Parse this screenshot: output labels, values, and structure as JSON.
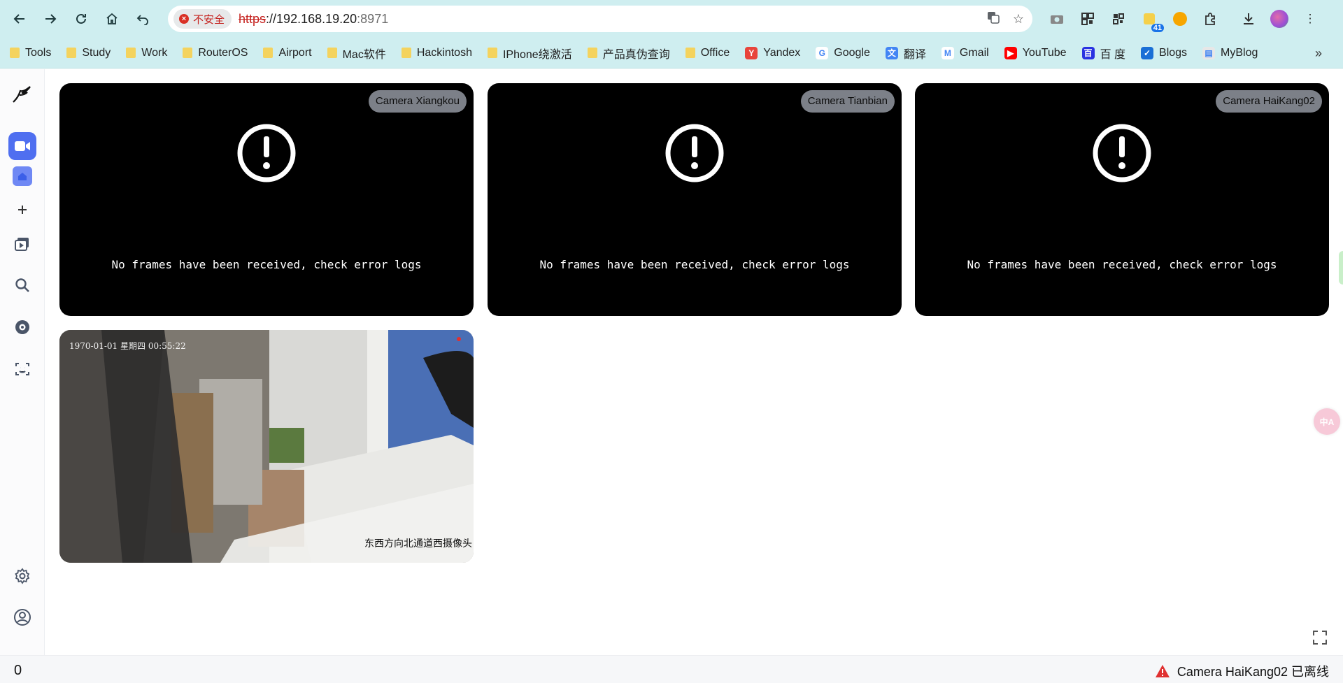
{
  "browser": {
    "security_label": "不安全",
    "url_scheme": "https",
    "url_host": "://192.168.19.20",
    "url_port": ":8971",
    "extension_badge": "41"
  },
  "bookmarks": [
    {
      "label": "Tools",
      "icon": "folder-icon"
    },
    {
      "label": "Study",
      "icon": "folder-icon"
    },
    {
      "label": "Work",
      "icon": "folder-icon"
    },
    {
      "label": "RouterOS",
      "icon": "folder-icon"
    },
    {
      "label": "Airport",
      "icon": "folder-icon"
    },
    {
      "label": "Mac软件",
      "icon": "folder-icon"
    },
    {
      "label": "Hackintosh",
      "icon": "folder-icon"
    },
    {
      "label": "IPhone绕激活",
      "icon": "folder-icon"
    },
    {
      "label": "产品真伪查询",
      "icon": "folder-icon"
    },
    {
      "label": "Office",
      "icon": "folder-icon"
    },
    {
      "label": "Yandex",
      "icon": "yandex-icon"
    },
    {
      "label": "Google",
      "icon": "google-icon"
    },
    {
      "label": "翻译",
      "icon": "translate-icon"
    },
    {
      "label": "Gmail",
      "icon": "gmail-icon"
    },
    {
      "label": "YouTube",
      "icon": "youtube-icon"
    },
    {
      "label": "百 度",
      "icon": "baidu-icon"
    },
    {
      "label": "Blogs",
      "icon": "blogs-icon"
    },
    {
      "label": "MyBlog",
      "icon": "myblog-icon"
    }
  ],
  "cameras": [
    {
      "name": "Camera Xiangkou",
      "message": "No frames have been received, check error logs"
    },
    {
      "name": "Camera Tianbian",
      "message": "No frames have been received, check error logs"
    },
    {
      "name": "Camera HaiKang02",
      "message": "No frames have been received, check error logs"
    },
    {
      "name": "",
      "osd_time": "1970-01-01 星期四 00:55:22",
      "osd_label": "东西方向北通道西摄像头"
    }
  ],
  "status": {
    "count": "0",
    "alert": "Camera HaiKang02 已离线"
  },
  "translate_fab": "中A"
}
